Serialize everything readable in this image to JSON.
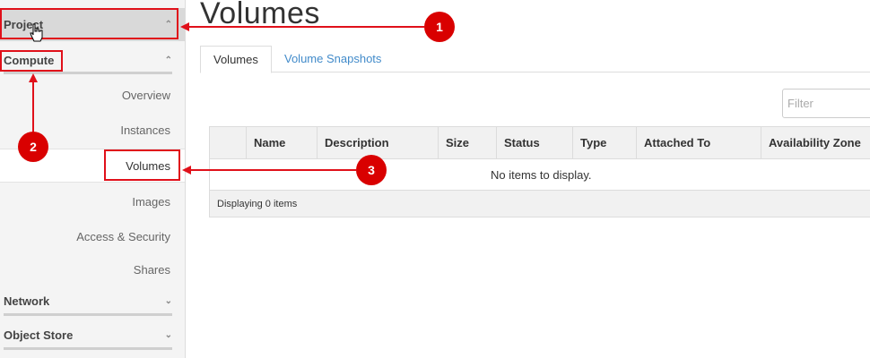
{
  "sidebar": {
    "project": "Project",
    "compute": "Compute",
    "items": [
      {
        "label": "Overview"
      },
      {
        "label": "Instances"
      },
      {
        "label": "Volumes"
      },
      {
        "label": "Images"
      },
      {
        "label": "Access & Security"
      },
      {
        "label": "Shares"
      }
    ],
    "network": "Network",
    "object_store": "Object Store"
  },
  "main": {
    "title": "Volumes",
    "tabs": [
      {
        "label": "Volumes"
      },
      {
        "label": "Volume Snapshots"
      }
    ],
    "filter_placeholder": "Filter",
    "columns": [
      "Name",
      "Description",
      "Size",
      "Status",
      "Type",
      "Attached To",
      "Availability Zone"
    ],
    "empty_message": "No items to display.",
    "footer": "Displaying 0 items"
  },
  "annotations": {
    "badges": [
      "1",
      "2",
      "3"
    ],
    "color": "#e0101a"
  }
}
